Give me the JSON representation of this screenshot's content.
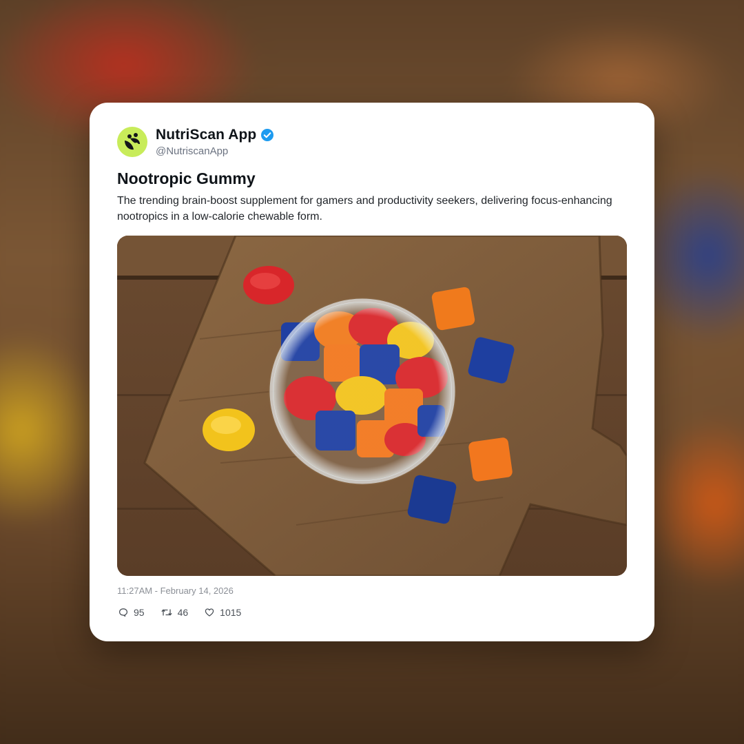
{
  "post": {
    "author": {
      "display_name": "NutriScan App",
      "handle": "@NutriscanApp",
      "verified": true,
      "avatar_color": "#c8ec5a"
    },
    "title": "Nootropic Gummy",
    "body": "The trending brain-boost supplement for gamers and productivity seekers, delivering focus-enhancing nootropics in a low-calorie chewable form.",
    "image_icon": "gummies-photo",
    "timestamp": "11:27AM - February 14, 2026",
    "stats": {
      "replies": "95",
      "reposts": "46",
      "likes": "1015"
    }
  },
  "icons": {
    "verified": "verified-check-icon",
    "reply": "comment-icon",
    "repost": "repost-icon",
    "like": "heart-icon"
  },
  "colors": {
    "verified_blue": "#1d9bf0",
    "text_primary": "#0f1419",
    "text_muted": "#6b7280"
  }
}
